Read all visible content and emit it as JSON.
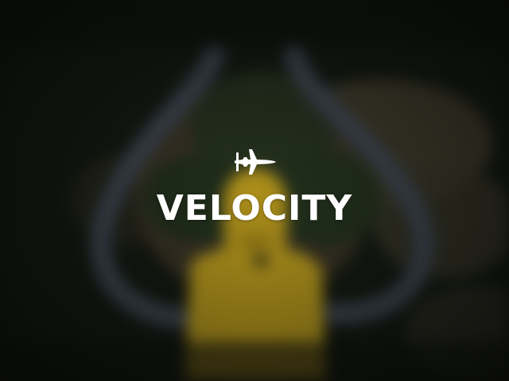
{
  "app": {
    "title": "VELOCITY",
    "logo_icon": "fighter-jet-icon"
  },
  "background": {
    "description_colors": {
      "base": "#141812",
      "forest": "#1d2a1a",
      "road": "#3e4650",
      "ground": "#6b5a3e",
      "raincoat": "#b89a1c"
    }
  },
  "colors": {
    "title_text": "#ffffff",
    "icon": "#ffffff"
  }
}
